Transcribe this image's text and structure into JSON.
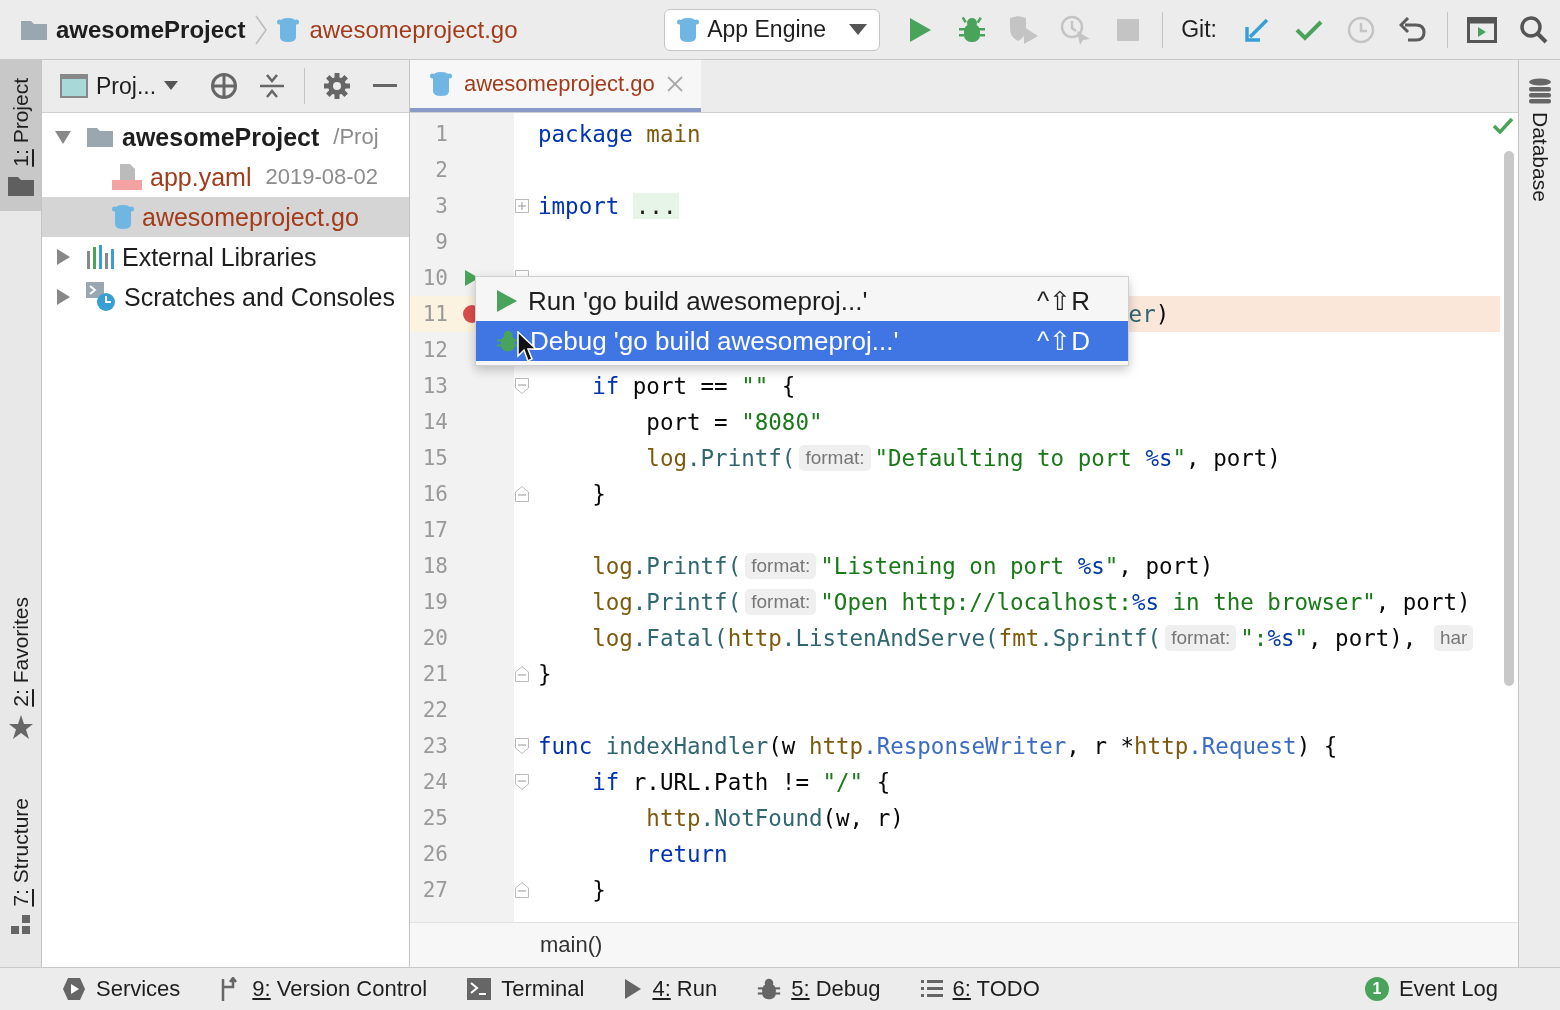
{
  "breadcrumb": {
    "project": "awesomeProject",
    "file": "awesomeproject.go",
    "unversioned": true
  },
  "run_config": {
    "label": "App Engine"
  },
  "toolbar": [
    {
      "kind": "run",
      "disabled": false
    },
    {
      "kind": "debug",
      "disabled": false
    },
    {
      "kind": "coverage",
      "disabled": true
    },
    {
      "kind": "profile",
      "disabled": true
    },
    {
      "kind": "stop",
      "disabled": true
    }
  ],
  "git": {
    "label": "Git:",
    "actions": [
      {
        "kind": "update",
        "disabled": false
      },
      {
        "kind": "commit",
        "disabled": false
      },
      {
        "kind": "history",
        "disabled": true
      },
      {
        "kind": "rollback",
        "disabled": false
      }
    ]
  },
  "left_stripe": [
    {
      "label": "1: Project",
      "kind": "project",
      "selected": true
    },
    {
      "label": "2: Favorites",
      "kind": "favorites",
      "selected": false
    },
    {
      "label": "7: Structure",
      "kind": "structure",
      "selected": false
    }
  ],
  "project_panel": {
    "view": "Proj...",
    "tree": [
      {
        "label": "awesomeProject",
        "detail": "/Proj",
        "kind": "module",
        "unversioned": false,
        "expanded": true,
        "selected": false,
        "children": [
          {
            "label": "app.yaml",
            "detail": "2019-08-02",
            "kind": "yaml",
            "unversioned": true,
            "selected": false
          },
          {
            "label": "awesomeproject.go",
            "kind": "go",
            "unversioned": true,
            "selected": true
          }
        ]
      },
      {
        "label": "External Libraries",
        "kind": "libraries",
        "unversioned": false,
        "expanded": false,
        "selected": false
      },
      {
        "label": "Scratches and Consoles",
        "kind": "scratches",
        "unversioned": false,
        "expanded": false,
        "selected": false
      }
    ]
  },
  "editor": {
    "tabs": [
      {
        "label": "awesomeproject.go",
        "unversioned": true,
        "selected": true
      }
    ],
    "lines": [
      {
        "number": "1",
        "run_marker": false,
        "breakpoint": false,
        "covered": false,
        "fold_start": false,
        "fold_end": false,
        "folded": false,
        "tokens": [
          {
            "kind": "kw",
            "text": "package"
          },
          {
            "kind": "pkg",
            "text": " main"
          }
        ]
      },
      {
        "number": "2",
        "run_marker": false,
        "breakpoint": false,
        "fold_start": false,
        "fold_end": false,
        "folded": false
      },
      {
        "number": "3",
        "run_marker": false,
        "breakpoint": false,
        "covered": false,
        "fold_start": false,
        "fold_end": false,
        "folded": true,
        "tokens": [
          {
            "kind": "kw",
            "text": "import"
          },
          {
            "kind": "folded",
            "text": "..."
          }
        ]
      },
      {
        "number": "9",
        "run_marker": false,
        "breakpoint": false,
        "fold_start": false,
        "fold_end": false,
        "folded": false
      },
      {
        "number": "10",
        "run_marker": true,
        "breakpoint": false,
        "fold_start": true,
        "fold_end": false,
        "folded": false
      },
      {
        "number": "11",
        "run_marker": false,
        "breakpoint": true,
        "covered": true,
        "tokens": [
          {
            "kind": "fn",
            "text": "er"
          },
          {
            "kind": "plain",
            "text": ")"
          }
        ]
      },
      {
        "number": "12",
        "run_marker": false,
        "breakpoint": false
      },
      {
        "number": "13",
        "run_marker": false,
        "breakpoint": false,
        "covered": false,
        "fold_start": true,
        "fold_end": false,
        "folded": false,
        "tokens": [
          {
            "kind": "kw",
            "text": "    if"
          },
          {
            "kind": "plain",
            "text": " port == "
          },
          {
            "kind": "str",
            "text": "\"\""
          },
          {
            "kind": "plain",
            "text": " {"
          }
        ]
      },
      {
        "number": "14",
        "run_marker": false,
        "breakpoint": false,
        "covered": false,
        "fold_start": false,
        "fold_end": false,
        "folded": false,
        "tokens": [
          {
            "kind": "plain",
            "text": "        port = "
          },
          {
            "kind": "str",
            "text": "\"8080\""
          }
        ]
      },
      {
        "number": "15",
        "run_marker": false,
        "breakpoint": false,
        "covered": false,
        "fold_start": false,
        "fold_end": false,
        "folded": false,
        "tokens": [
          {
            "kind": "pkg",
            "text": "        log"
          },
          {
            "kind": "fn",
            "text": ".Printf("
          },
          {
            "kind": "hint",
            "text": "format:"
          },
          {
            "kind": "str",
            "text": "\"Defaulting to port "
          },
          {
            "kind": "fmt",
            "text": "%s"
          },
          {
            "kind": "str",
            "text": "\""
          },
          {
            "kind": "plain",
            "text": ", port)"
          }
        ]
      },
      {
        "number": "16",
        "run_marker": false,
        "breakpoint": false,
        "covered": false,
        "fold_start": false,
        "fold_end": true,
        "folded": false,
        "tokens": [
          {
            "kind": "plain",
            "text": "    }"
          }
        ]
      },
      {
        "number": "17",
        "run_marker": false,
        "breakpoint": false,
        "fold_start": false,
        "fold_end": false,
        "folded": false
      },
      {
        "number": "18",
        "run_marker": false,
        "breakpoint": false,
        "covered": false,
        "fold_start": false,
        "fold_end": false,
        "folded": false,
        "tokens": [
          {
            "kind": "pkg",
            "text": "    log"
          },
          {
            "kind": "fn",
            "text": ".Printf("
          },
          {
            "kind": "hint",
            "text": "format:"
          },
          {
            "kind": "str",
            "text": "\"Listening on port "
          },
          {
            "kind": "fmt",
            "text": "%s"
          },
          {
            "kind": "str",
            "text": "\""
          },
          {
            "kind": "plain",
            "text": ", port)"
          }
        ]
      },
      {
        "number": "19",
        "run_marker": false,
        "breakpoint": false,
        "covered": false,
        "fold_start": false,
        "fold_end": false,
        "folded": false,
        "tokens": [
          {
            "kind": "pkg",
            "text": "    log"
          },
          {
            "kind": "fn",
            "text": ".Printf("
          },
          {
            "kind": "hint",
            "text": "format:"
          },
          {
            "kind": "str",
            "text": "\"Open http://localhost:"
          },
          {
            "kind": "fmt",
            "text": "%s"
          },
          {
            "kind": "str",
            "text": " in the browser\""
          },
          {
            "kind": "plain",
            "text": ", port)"
          }
        ]
      },
      {
        "number": "20",
        "run_marker": false,
        "breakpoint": false,
        "covered": false,
        "fold_start": false,
        "fold_end": false,
        "folded": false,
        "tokens": [
          {
            "kind": "pkg",
            "text": "    log"
          },
          {
            "kind": "fn",
            "text": ".Fatal("
          },
          {
            "kind": "pkg",
            "text": "http"
          },
          {
            "kind": "fn",
            "text": ".ListenAndServe("
          },
          {
            "kind": "pkg",
            "text": "fmt"
          },
          {
            "kind": "fn",
            "text": ".Sprintf("
          },
          {
            "kind": "hint",
            "text": "format:"
          },
          {
            "kind": "str",
            "text": "\":"
          },
          {
            "kind": "fmt",
            "text": "%s"
          },
          {
            "kind": "str",
            "text": "\""
          },
          {
            "kind": "plain",
            "text": ", port), "
          },
          {
            "kind": "hint",
            "text": "har"
          }
        ]
      },
      {
        "number": "21",
        "run_marker": false,
        "breakpoint": false,
        "covered": false,
        "fold_start": false,
        "fold_end": true,
        "folded": false,
        "tokens": [
          {
            "kind": "plain",
            "text": "}"
          }
        ]
      },
      {
        "number": "22",
        "run_marker": false,
        "breakpoint": false,
        "fold_start": false,
        "fold_end": false,
        "folded": false
      },
      {
        "number": "23",
        "run_marker": false,
        "breakpoint": false,
        "covered": false,
        "fold_start": true,
        "fold_end": false,
        "folded": false,
        "tokens": [
          {
            "kind": "kw",
            "text": "func"
          },
          {
            "kind": "fn",
            "text": " indexHandler"
          },
          {
            "kind": "plain",
            "text": "(w "
          },
          {
            "kind": "pkg",
            "text": "http"
          },
          {
            "kind": "type",
            "text": ".ResponseWriter"
          },
          {
            "kind": "plain",
            "text": ", r *"
          },
          {
            "kind": "pkg",
            "text": "http"
          },
          {
            "kind": "type",
            "text": ".Request"
          },
          {
            "kind": "plain",
            "text": ") {"
          }
        ]
      },
      {
        "number": "24",
        "run_marker": false,
        "breakpoint": false,
        "covered": false,
        "fold_start": true,
        "fold_end": false,
        "folded": false,
        "tokens": [
          {
            "kind": "kw",
            "text": "    if"
          },
          {
            "kind": "plain",
            "text": " r.URL.Path != "
          },
          {
            "kind": "str",
            "text": "\"/\""
          },
          {
            "kind": "plain",
            "text": " {"
          }
        ]
      },
      {
        "number": "25",
        "run_marker": false,
        "breakpoint": false,
        "covered": false,
        "fold_start": false,
        "fold_end": false,
        "folded": false,
        "tokens": [
          {
            "kind": "pkg",
            "text": "        http"
          },
          {
            "kind": "fn",
            "text": ".NotFound"
          },
          {
            "kind": "plain",
            "text": "(w, r)"
          }
        ]
      },
      {
        "number": "26",
        "run_marker": false,
        "breakpoint": false,
        "covered": false,
        "fold_start": false,
        "fold_end": false,
        "folded": false,
        "tokens": [
          {
            "kind": "kw",
            "text": "        return"
          }
        ]
      },
      {
        "number": "27",
        "run_marker": false,
        "breakpoint": false,
        "covered": false,
        "fold_start": false,
        "fold_end": true,
        "folded": false,
        "tokens": [
          {
            "kind": "plain",
            "text": "    }"
          }
        ]
      }
    ],
    "popup": [
      {
        "kind": "run",
        "label": "Run 'go build awesomeproj...'",
        "shortcut": "^⇧R",
        "selected": false
      },
      {
        "kind": "debug",
        "label": "Debug 'go build awesomeproj...'",
        "shortcut": "^⇧D",
        "selected": true
      }
    ],
    "breadcrumb": "main()"
  },
  "right_stripe": [
    {
      "label": "Database",
      "kind": "database",
      "selected": false
    }
  ],
  "bottom_tools": [
    {
      "label": "Services",
      "kind": "services",
      "mnemonic": false
    },
    {
      "label": "9: Version Control",
      "kind": "vcs",
      "mnemonic": true
    },
    {
      "label": "Terminal",
      "kind": "terminal",
      "mnemonic": false
    },
    {
      "label": "4: Run",
      "kind": "run",
      "mnemonic": true
    },
    {
      "label": "5: Debug",
      "kind": "debug",
      "mnemonic": true
    },
    {
      "label": "6: TODO",
      "kind": "todo",
      "mnemonic": true
    },
    {
      "label": "Event Log",
      "kind": "events",
      "mnemonic": false,
      "badge": "1"
    }
  ]
}
